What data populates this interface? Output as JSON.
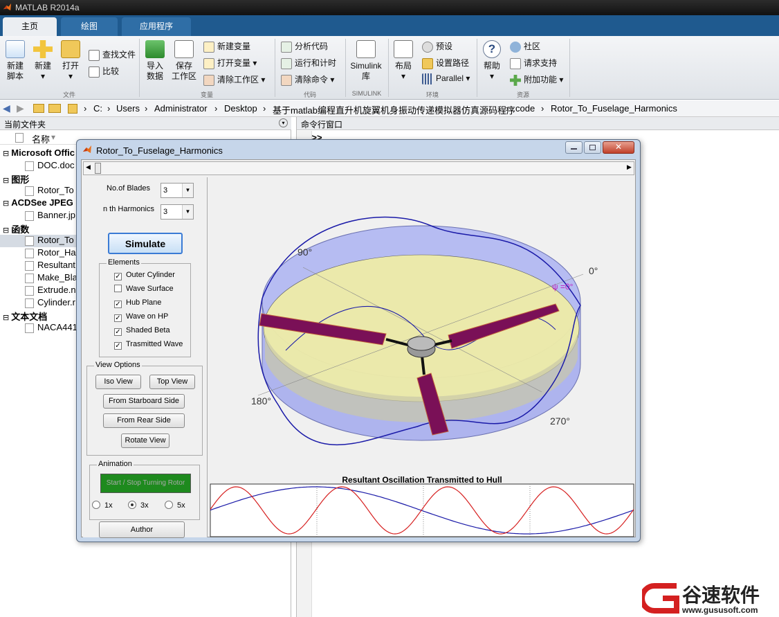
{
  "app": {
    "title": "MATLAB R2014a"
  },
  "tabs": [
    "主页",
    "绘图",
    "应用程序"
  ],
  "ribbon": {
    "new_script": [
      "新建",
      "脚本"
    ],
    "new_label": "新建",
    "open_label": "打开",
    "find_files": "查找文件",
    "compare": "比较",
    "import_data": [
      "导入",
      "数据"
    ],
    "save_workspace": [
      "保存",
      "工作区"
    ],
    "new_variable": "新建变量",
    "open_variable": "打开变量",
    "clear_workspace": "清除工作区",
    "analyze_code": "分析代码",
    "run_time": "运行和计时",
    "clear_commands": "清除命令",
    "simulink": [
      "Simulink",
      "库"
    ],
    "layout": "布局",
    "preferences": "预设",
    "set_path": "设置路径",
    "parallel": "Parallel",
    "help": "帮助",
    "community": "社区",
    "request_support": "请求支持",
    "addons": "附加功能",
    "groups": {
      "file": "文件",
      "variable": "变量",
      "code": "代码",
      "simulink": "SIMULINK",
      "environment": "环境",
      "resources": "资源"
    }
  },
  "address": {
    "crumbs": [
      "C:",
      "Users",
      "Administrator",
      "Desktop",
      "基于matlab编程直升机旋翼机身振动传递模拟器仿真源码程序",
      "code",
      "Rotor_To_Fuselage_Harmonics"
    ]
  },
  "left_panel": {
    "title": "当前文件夹",
    "col_name": "名称",
    "tree": [
      {
        "label": "Microsoft Offic",
        "bold": true
      },
      {
        "label": "DOC.doc",
        "bold": false
      },
      {
        "label": "图形",
        "bold": true
      },
      {
        "label": "Rotor_To",
        "bold": false
      },
      {
        "label": "ACDSee JPEG E",
        "bold": true
      },
      {
        "label": "Banner.jp",
        "bold": false
      },
      {
        "label": "函数",
        "bold": true
      },
      {
        "label": "Rotor_To",
        "bold": false
      },
      {
        "label": "Rotor_Ha",
        "bold": false
      },
      {
        "label": "Resultant",
        "bold": false
      },
      {
        "label": "Make_Bla",
        "bold": false
      },
      {
        "label": "Extrude.n",
        "bold": false
      },
      {
        "label": "Cylinder.r",
        "bold": false
      },
      {
        "label": "文本文档",
        "bold": true
      },
      {
        "label": "NACA441",
        "bold": false
      }
    ]
  },
  "right_panel": {
    "title": "命令行窗口",
    "prompt": "fx >>"
  },
  "window": {
    "title": "Rotor_To_Fuselage_Harmonics",
    "blades_label": "No.of Blades",
    "blades_value": "3",
    "harmonics_label": "n th Harmonics",
    "harmonics_value": "3",
    "simulate": "Simulate",
    "elements_title": "Elements",
    "elements": [
      {
        "label": "Outer Cylinder",
        "checked": true
      },
      {
        "label": "Wave Surface",
        "checked": false
      },
      {
        "label": "Hub Plane",
        "checked": true
      },
      {
        "label": "Wave on HP",
        "checked": true
      },
      {
        "label": "Shaded Beta",
        "checked": true
      },
      {
        "label": "Trasmitted Wave",
        "checked": true
      }
    ],
    "view_title": "View Options",
    "iso_view": "Iso View",
    "top_view": "Top View",
    "starboard": "From Starboard Side",
    "rear": "From Rear Side",
    "rotate": "Rotate View",
    "animation_title": "Animation",
    "start_stop": "Start / Stop Turning Rotor",
    "speeds": [
      {
        "label": "1x",
        "on": false
      },
      {
        "label": "3x",
        "on": true
      },
      {
        "label": "5x",
        "on": false
      }
    ],
    "author": "Author",
    "plot_labels": {
      "a90": "90°",
      "a0": "0°",
      "a180": "180°",
      "a270": "270°",
      "psi": "ψ =0°"
    },
    "plot2d_title": "Resultant Oscillation Transmitted to Hull"
  },
  "watermark": {
    "text": "谷速软件",
    "url": "www.gususoft.com"
  },
  "colors": {
    "accent_blue": "#1f5a8f",
    "cyl_fill": "#9da6e8",
    "disk_fill": "#f3f0a0",
    "blade": "#7a1057",
    "start_btn": "#1e8a1e",
    "wave_blue": "#1a1aa8",
    "wave_red": "#d62020"
  }
}
